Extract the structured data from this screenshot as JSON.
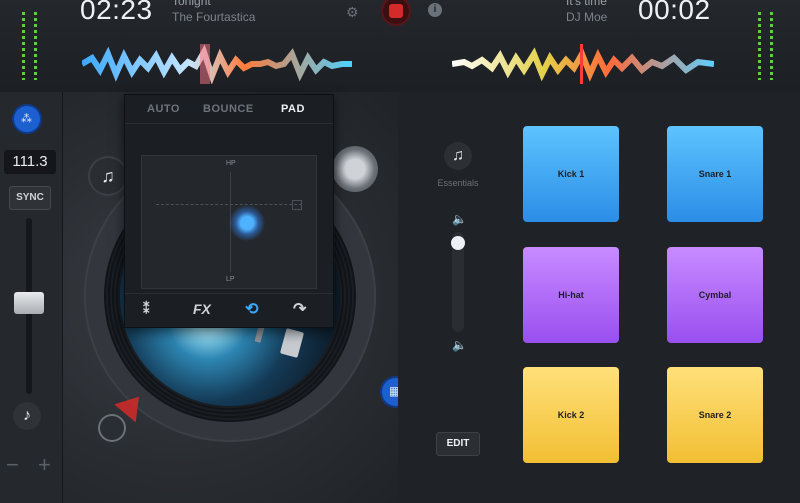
{
  "top": {
    "left_time": "02:23",
    "left_track_title": "Tonight",
    "left_track_artist": "The Fourtastica",
    "right_track_title": "It's time",
    "right_track_artist": "DJ Moe",
    "right_time": "00:02"
  },
  "left": {
    "bpm": "111.3",
    "sync_label": "SYNC",
    "minus_label": "−",
    "plus_label": "+"
  },
  "fx": {
    "tabs": [
      "AUTO",
      "BOUNCE",
      "PAD"
    ],
    "active_tab": "PAD",
    "xy_top_label": "HP",
    "xy_bottom_label": "LP",
    "fx_label": "FX"
  },
  "sampler": {
    "pack_label": "Essentials",
    "edit_label": "EDIT",
    "pads": [
      {
        "label": "Kick 1",
        "color": "#4aaeff"
      },
      {
        "label": "Snare 1",
        "color": "#4aaeff"
      },
      {
        "label": "Hi-hat",
        "color": "#b06bff"
      },
      {
        "label": "Cymbal",
        "color": "#b06bff"
      },
      {
        "label": "Kick 2",
        "color": "#f7cf4a"
      },
      {
        "label": "Snare 2",
        "color": "#f7cf4a"
      }
    ]
  }
}
